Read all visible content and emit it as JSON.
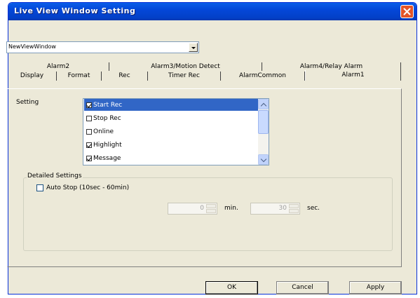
{
  "window": {
    "title": "Live View Window Setting"
  },
  "view_selector": {
    "value": "NewViewWindow"
  },
  "tabs": {
    "row_top": [
      "Alarm2",
      "Alarm3/Motion Detect",
      "Alarm4/Relay Alarm"
    ],
    "row_bottom": [
      "Display",
      "Format",
      "Rec",
      "Timer Rec",
      "AlarmCommon",
      "Alarm1"
    ],
    "active": "Alarm1"
  },
  "setting": {
    "label": "Setting",
    "items": [
      {
        "label": "Start Rec",
        "checked": true,
        "selected": true
      },
      {
        "label": "Stop Rec",
        "checked": false,
        "selected": false
      },
      {
        "label": "Online",
        "checked": false,
        "selected": false
      },
      {
        "label": "Highlight",
        "checked": true,
        "selected": false
      },
      {
        "label": "Message",
        "checked": true,
        "selected": false
      }
    ]
  },
  "detailed": {
    "title": "Detailed Settings",
    "auto_stop_label": "Auto Stop (10sec - 60min)",
    "auto_stop_checked": false,
    "minutes_value": "0",
    "minutes_unit": "min.",
    "seconds_value": "30",
    "seconds_unit": "sec."
  },
  "buttons": {
    "ok": "OK",
    "cancel": "Cancel",
    "apply": "Apply"
  },
  "colors": {
    "titlebar": "#0447d8",
    "selection": "#3166c6",
    "dialog_bg": "#ece9d8",
    "close": "#e35428"
  }
}
